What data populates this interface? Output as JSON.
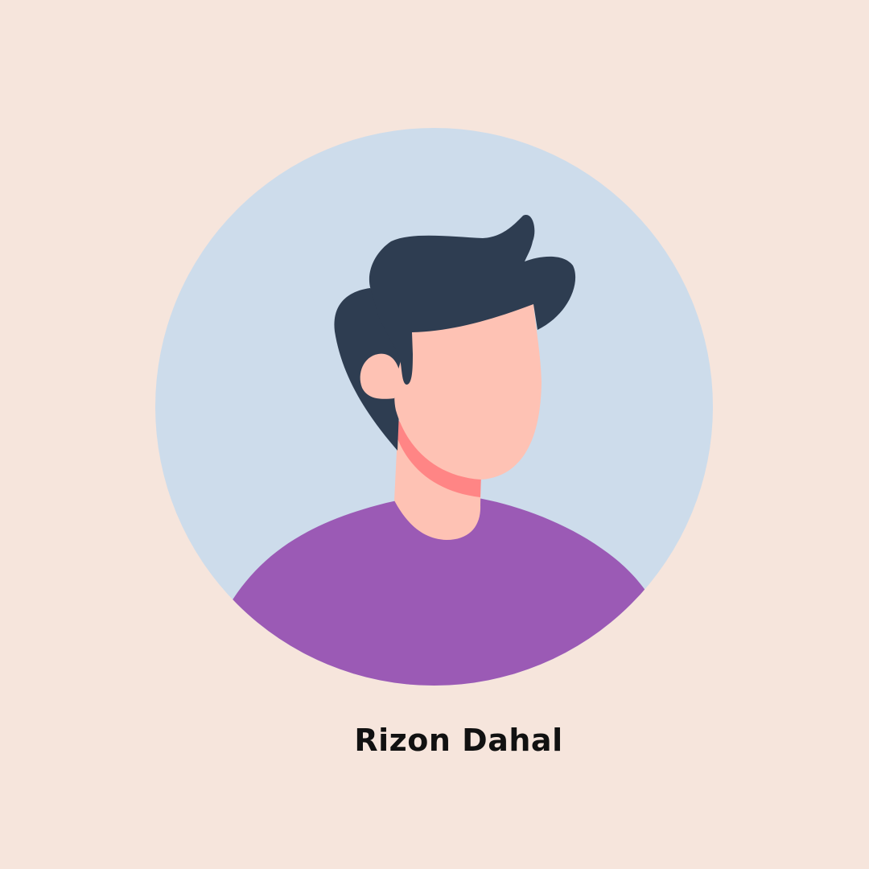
{
  "profile": {
    "name": "Rizon Dahal"
  },
  "colors": {
    "background": "#f6e5dc",
    "circle": "#cddceb",
    "hair": "#2e3d51",
    "skin": "#fec2b4",
    "neck_shadow": "#ff8585",
    "shirt": "#9b5ab5",
    "text": "#111111"
  }
}
